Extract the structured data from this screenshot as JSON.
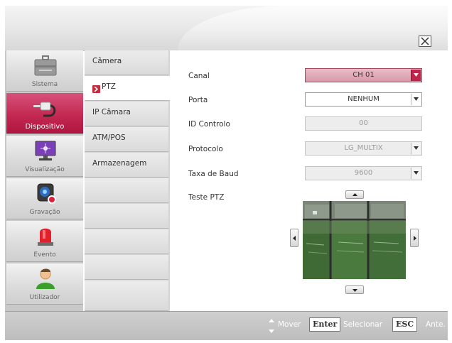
{
  "window": {
    "close_icon": "close-x-icon"
  },
  "sidebar": {
    "items": [
      {
        "label": "Sistema",
        "icon": "toolbox-icon",
        "active": false
      },
      {
        "label": "Dispositivo",
        "icon": "cable-connector-icon",
        "active": true
      },
      {
        "label": "Visualização",
        "icon": "monitor-icon",
        "active": false
      },
      {
        "label": "Gravação",
        "icon": "camera-record-icon",
        "active": false
      },
      {
        "label": "Evento",
        "icon": "alarm-light-icon",
        "active": false
      },
      {
        "label": "Utilizador",
        "icon": "user-icon",
        "active": false
      }
    ]
  },
  "subnav": {
    "items": [
      {
        "label": "Câmera",
        "active": false
      },
      {
        "label": "PTZ",
        "active": true
      },
      {
        "label": "IP Câmara",
        "active": false
      },
      {
        "label": "ATM/POS",
        "active": false
      },
      {
        "label": "Armazenagem",
        "active": false
      }
    ]
  },
  "form": {
    "canal": {
      "label": "Canal",
      "value": "CH 01"
    },
    "porta": {
      "label": "Porta",
      "value": "NENHUM"
    },
    "id_controlo": {
      "label": "ID Controlo",
      "value": "00"
    },
    "protocolo": {
      "label": "Protocolo",
      "value": "LG_MULTIX"
    },
    "taxa_baud": {
      "label": "Taxa de Baud",
      "value": "9600"
    },
    "teste_ptz": {
      "label": "Teste PTZ"
    }
  },
  "footer": {
    "move_label": "Mover",
    "enter_key": "Enter",
    "select_label": "Selecionar",
    "esc_key": "ESC",
    "back_label": "Ante."
  },
  "colors": {
    "accent": "#c1264f",
    "footer_bg": "#c4c4c4",
    "disabled_field": "#ededed"
  }
}
